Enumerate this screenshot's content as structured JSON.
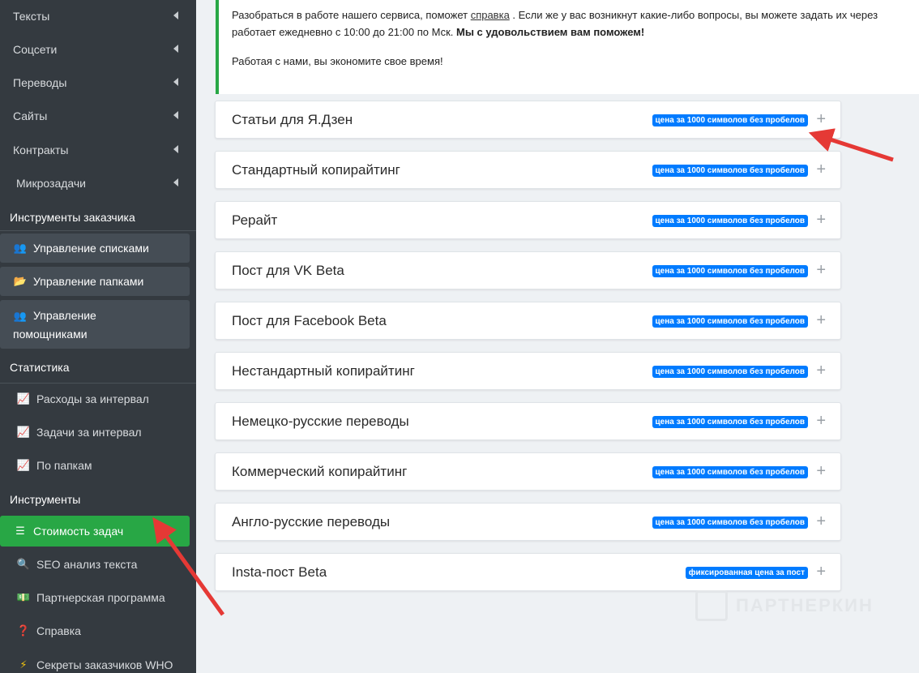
{
  "sidebar": {
    "menu": [
      {
        "label": "Тексты"
      },
      {
        "label": "Соцсети"
      },
      {
        "label": "Переводы"
      },
      {
        "label": "Сайты"
      },
      {
        "label": "Контракты"
      },
      {
        "label": "Микрозадачи"
      }
    ],
    "customer_tools_title": "Инструменты заказчика",
    "customer_tools": [
      {
        "label": "Управление списками",
        "icon": "users-icon"
      },
      {
        "label": "Управление папками",
        "icon": "folder-icon"
      },
      {
        "label_line1": "Управление",
        "label_line2": "помощниками",
        "icon": "users-icon"
      }
    ],
    "stats_title": "Статистика",
    "stats": [
      {
        "label": "Расходы за интервал",
        "icon": "chart-line-icon"
      },
      {
        "label": "Задачи за интервал",
        "icon": "chart-line-icon"
      },
      {
        "label": "По папкам",
        "icon": "chart-line-icon"
      }
    ],
    "tools_title": "Инструменты",
    "tools": [
      {
        "label": "Стоимость задач",
        "icon": "list-icon",
        "active": true
      },
      {
        "label": "SEO анализ текста",
        "icon": "search-icon"
      },
      {
        "label": "Партнерская программа",
        "icon": "money-icon"
      },
      {
        "label": "Справка",
        "icon": "question-icon"
      },
      {
        "label": "Секреты заказчиков WHO",
        "icon": "bolt-icon"
      }
    ]
  },
  "info": {
    "line1_before": "Разобраться в работе нашего сервиса, поможет ",
    "line1_link": "справка",
    "line1_after": " . Если же у вас возникнут какие-либо вопросы, вы можете задать их через",
    "line2_before": "работает ежедневно с 10:00 до 21:00 по Мск. ",
    "line2_bold": "Мы с удовольствием вам поможем!",
    "line3": "Работая с нами, вы экономите свое время!"
  },
  "services": [
    {
      "title": "Статьи для Я.Дзен",
      "badge": "цена за 1000 символов без пробелов"
    },
    {
      "title": "Стандартный копирайтинг",
      "badge": "цена за 1000 символов без пробелов"
    },
    {
      "title": "Рерайт",
      "badge": "цена за 1000 символов без пробелов"
    },
    {
      "title": "Пост для VK Beta",
      "badge": "цена за 1000 символов без пробелов"
    },
    {
      "title": "Пост для Facebook Beta",
      "badge": "цена за 1000 символов без пробелов"
    },
    {
      "title": "Нестандартный копирайтинг",
      "badge": "цена за 1000 символов без пробелов"
    },
    {
      "title": "Немецко-русские переводы",
      "badge": "цена за 1000 символов без пробелов"
    },
    {
      "title": "Коммерческий копирайтинг",
      "badge": "цена за 1000 символов без пробелов"
    },
    {
      "title": "Англо-русские переводы",
      "badge": "цена за 1000 символов без пробелов"
    },
    {
      "title": "Insta-пост Beta",
      "badge": "фиксированная цена за пост"
    }
  ],
  "plus_symbol": "+",
  "watermark": "ПАРТНЕРКИН",
  "colors": {
    "sidebar": "#343a40",
    "active": "#28a745",
    "badge": "#007bff",
    "arrow": "#e53935"
  }
}
